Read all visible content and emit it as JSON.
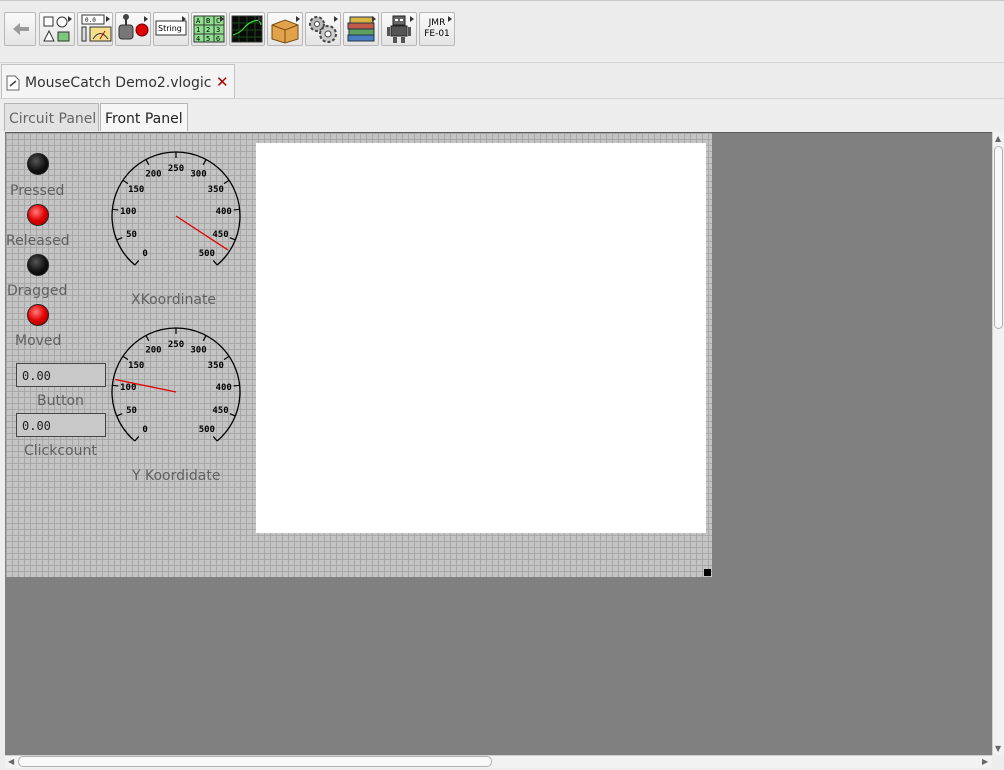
{
  "toolbar": {
    "buttons": [
      {
        "name": "back",
        "icon": "back-arrow-icon"
      },
      {
        "name": "shapes",
        "icon": "shapes-icon"
      },
      {
        "name": "io-instruments",
        "icon": "io-meter-icon"
      },
      {
        "name": "controls",
        "icon": "joystick-led-icon"
      },
      {
        "name": "string",
        "icon": "string-icon",
        "label": "String"
      },
      {
        "name": "table",
        "icon": "table-icon",
        "cells": [
          "A",
          "B",
          "C",
          "1",
          "2",
          "3",
          "4",
          "5",
          "6"
        ]
      },
      {
        "name": "oscilloscope",
        "icon": "oscilloscope-icon"
      },
      {
        "name": "package",
        "icon": "box-icon"
      },
      {
        "name": "settings",
        "icon": "gears-icon"
      },
      {
        "name": "library",
        "icon": "books-icon"
      },
      {
        "name": "robot",
        "icon": "robot-icon"
      },
      {
        "name": "jmr",
        "icon": "jmr-icon",
        "label_line1": "JMR",
        "label_line2": "FE-01"
      }
    ]
  },
  "document_tab": {
    "title": "MouseCatch Demo2.vlogic",
    "close_symbol": "✕"
  },
  "panel_tabs": [
    {
      "label": "Circuit Panel",
      "active": false
    },
    {
      "label": "Front Panel",
      "active": true
    }
  ],
  "front_panel": {
    "indicators": [
      {
        "label": "Pressed",
        "state": "off"
      },
      {
        "label": "Released",
        "state": "on"
      },
      {
        "label": "Dragged",
        "state": "off"
      },
      {
        "label": "Moved",
        "state": "on"
      }
    ],
    "numeric_displays": [
      {
        "label": "Button",
        "value": "0.00"
      },
      {
        "label": "Clickcount",
        "value": "0.00"
      }
    ],
    "gauges": [
      {
        "label": "XKoordinate",
        "min": 0,
        "max": 500,
        "ticks": [
          "0",
          "50",
          "100",
          "150",
          "200",
          "250",
          "300",
          "350",
          "400",
          "450",
          "500"
        ],
        "value": 470
      },
      {
        "label": "Y Koordidate",
        "min": 0,
        "max": 500,
        "ticks": [
          "0",
          "50",
          "100",
          "150",
          "200",
          "250",
          "300",
          "350",
          "400",
          "450",
          "500"
        ],
        "value": 110
      }
    ],
    "colors": {
      "led_on": "#e00000",
      "led_off": "#111111",
      "needle": "#e00000",
      "grid_bg": "#c4c4c4",
      "workspace": "#808080"
    }
  }
}
